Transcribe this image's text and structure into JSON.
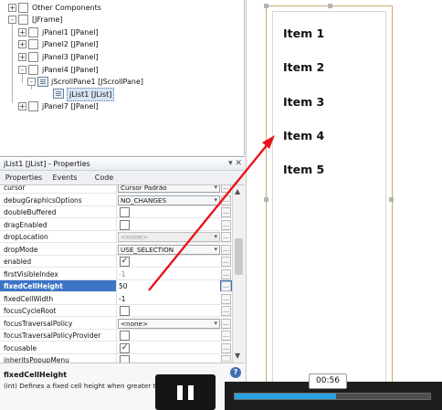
{
  "navigator": {
    "nodes": [
      {
        "label": "Other Components",
        "depth": 1,
        "type": "checkbox",
        "expander": "+"
      },
      {
        "label": "[JFrame]",
        "depth": 1,
        "type": "checkbox",
        "expander": "-"
      },
      {
        "label": "jPanel1 [JPanel]",
        "depth": 2,
        "type": "checkbox",
        "expander": "+"
      },
      {
        "label": "jPanel2 [JPanel]",
        "depth": 2,
        "type": "checkbox",
        "expander": "+"
      },
      {
        "label": "jPanel3 [JPanel]",
        "depth": 2,
        "type": "checkbox",
        "expander": "+"
      },
      {
        "label": "jPanel4 [JPanel]",
        "depth": 2,
        "type": "checkbox",
        "expander": "-"
      },
      {
        "label": "jScrollPane1 [JScrollPane]",
        "depth": 3,
        "type": "component",
        "expander": "-"
      },
      {
        "label": "jList1 [JList]",
        "depth": 4,
        "type": "component",
        "expander": ""
      },
      {
        "label": "jPanel7 [JPanel]",
        "depth": 2,
        "type": "checkbox",
        "expander": "+"
      }
    ]
  },
  "properties": {
    "header_title": "jList1 [JList] - Properties",
    "tabs": [
      {
        "label": "Properties",
        "active": true
      },
      {
        "label": "Events",
        "active": false
      },
      {
        "label": "Code",
        "active": false
      }
    ],
    "rows": [
      {
        "name": "cursor",
        "kind": "dropdown",
        "value": "Cursor Padrão",
        "disabled": false,
        "highlight": false
      },
      {
        "name": "debugGraphicsOptions",
        "kind": "dropdown",
        "value": "NO_CHANGES",
        "disabled": false,
        "highlight": false
      },
      {
        "name": "doubleBuffered",
        "kind": "checkbox",
        "value": "",
        "checked": false,
        "highlight": false
      },
      {
        "name": "dragEnabled",
        "kind": "checkbox",
        "value": "",
        "checked": false,
        "highlight": false
      },
      {
        "name": "dropLocation",
        "kind": "dropdown",
        "value": "<none>",
        "disabled": true,
        "highlight": false
      },
      {
        "name": "dropMode",
        "kind": "dropdown",
        "value": "USE_SELECTION",
        "disabled": false,
        "highlight": false
      },
      {
        "name": "enabled",
        "kind": "checkbox",
        "value": "",
        "checked": true,
        "highlight": false
      },
      {
        "name": "firstVisibleIndex",
        "kind": "text",
        "value": "-1",
        "muted": true,
        "highlight": false
      },
      {
        "name": "fixedCellHeight",
        "kind": "text",
        "value": "50",
        "muted": false,
        "highlight": true
      },
      {
        "name": "fixedCellWidth",
        "kind": "text",
        "value": "-1",
        "muted": false,
        "highlight": false
      },
      {
        "name": "focusCycleRoot",
        "kind": "checkbox",
        "value": "",
        "checked": false,
        "highlight": false
      },
      {
        "name": "focusTraversalPolicy",
        "kind": "dropdown",
        "value": "<none>",
        "disabled": false,
        "highlight": false
      },
      {
        "name": "focusTraversalPolicyProvider",
        "kind": "checkbox",
        "value": "",
        "checked": false,
        "highlight": false
      },
      {
        "name": "focusable",
        "kind": "checkbox",
        "value": "",
        "checked": true,
        "highlight": false
      },
      {
        "name": "inheritsPopupMenu",
        "kind": "checkbox",
        "value": "",
        "checked": false,
        "highlight": false
      }
    ],
    "description_title": "fixedCellHeight",
    "description_text": "(int) Defines a fixed cell height when greater than zero"
  },
  "canvas": {
    "list_items": [
      "Item 1",
      "Item 2",
      "Item 3",
      "Item 4",
      "Item 5"
    ]
  },
  "video": {
    "time": "00:56",
    "progress": 0.52,
    "accent": "#27a3df"
  },
  "colors": {
    "selection": "#3d75c6",
    "arrow": "#e8141b"
  }
}
